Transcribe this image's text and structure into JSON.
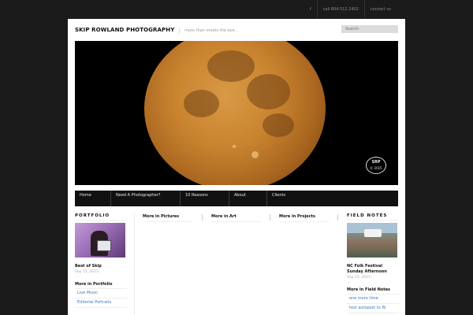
{
  "top": {
    "links": [
      "f",
      "call 804.512.2402",
      "contact us"
    ]
  },
  "site": {
    "title": "SKIP ROWLAND PHOTOGRAPHY",
    "tagline": "more than meets the eye...",
    "search_placeholder": "Search"
  },
  "hero": {
    "watermark": "SRP",
    "watermark_year": "© 2015"
  },
  "nav": {
    "items": [
      "Home",
      "Need A Photographer?",
      "10 Reasons",
      "About",
      "Clients"
    ]
  },
  "portfolio": {
    "label": "PORTFOLIO",
    "post_title": "Best of Skip",
    "post_date": "Sep 15, 2015",
    "dots": "...",
    "more_title": "More in Portfolio",
    "links": [
      "Live Music",
      "Editorial Portraits"
    ]
  },
  "columns": {
    "pictures": "More in Pictures",
    "art": "More in Art",
    "projects": "More in Projects"
  },
  "fieldnotes": {
    "label": "FIELD NOTES",
    "post_title": "NC Folk Festival Sunday Afternoon",
    "post_date": "Sep 15, 2015",
    "dots": "...",
    "more_title": "More in Field Notes",
    "links": [
      "one more time",
      "test autopost to fb"
    ]
  },
  "colors": {
    "page_bg": "#1b1b1b",
    "nav_bg": "#111111",
    "link": "#3a7bbf"
  }
}
